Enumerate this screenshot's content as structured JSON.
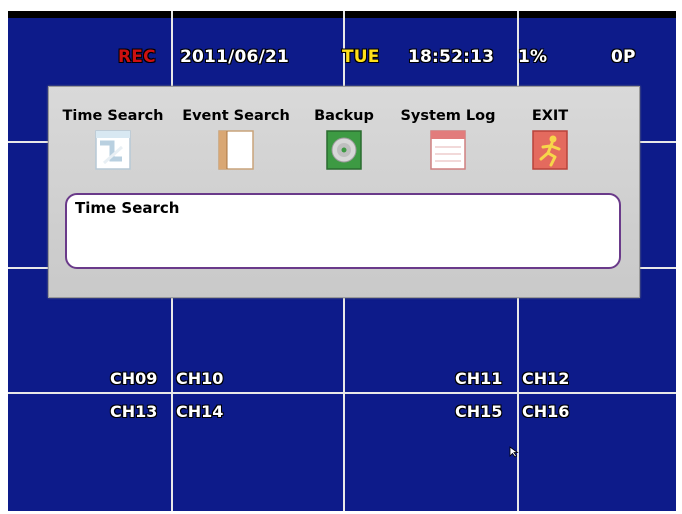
{
  "status_bar": {
    "rec_label": "REC",
    "date": "2011/06/21",
    "weekday": "TUE",
    "time": "18:52:13",
    "hdd_usage": "1%",
    "playback_count": "0P"
  },
  "menu": {
    "items": [
      {
        "label": "Time Search",
        "icon": "time-search-icon"
      },
      {
        "label": "Event Search",
        "icon": "event-search-icon"
      },
      {
        "label": "Backup",
        "icon": "backup-disc-icon"
      },
      {
        "label": "System Log",
        "icon": "system-log-icon"
      },
      {
        "label": "EXIT",
        "icon": "exit-running-man-icon"
      }
    ],
    "description": "Time Search"
  },
  "channels": {
    "row1": [
      "CH09",
      "CH10",
      "CH11",
      "CH12"
    ],
    "row2": [
      "CH13",
      "CH14",
      "CH15",
      "CH16"
    ]
  },
  "colors": {
    "screen_background": "#0d1b8a",
    "rec_red": "#cc1010",
    "weekday_yellow": "#ffe01a",
    "panel_gray": "#d2d2d2",
    "grid_line": "#e8e8e8"
  }
}
